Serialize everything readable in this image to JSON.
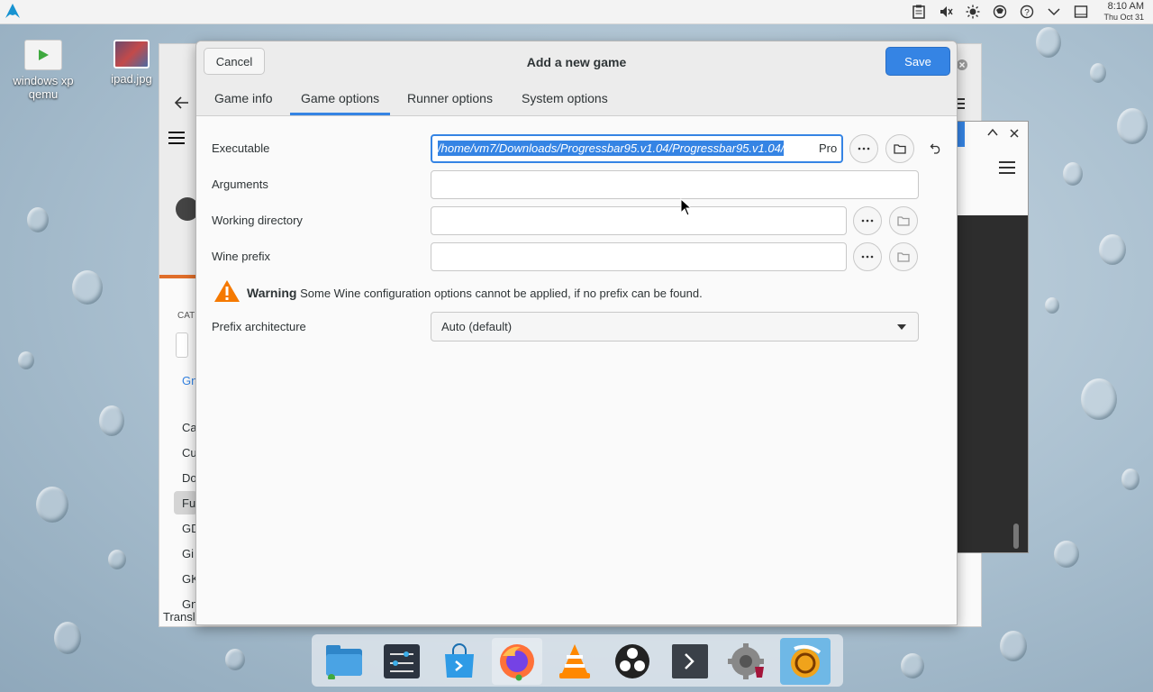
{
  "top_panel": {
    "time": "8:10 AM",
    "date": "Thu Oct 31",
    "tray_icons": [
      "clipboard-icon",
      "volume-muted-icon",
      "brightness-icon",
      "network-icon",
      "help-icon",
      "chevron-down-icon",
      "window-icon"
    ]
  },
  "desktop": {
    "icons": [
      {
        "label": "windows xp qemu",
        "icon": "play-icon"
      },
      {
        "label": "ipad.jpg",
        "icon": "image-icon"
      }
    ]
  },
  "background_windows": {
    "left_window_fragments": [
      "CATE",
      "Gn",
      "Ca",
      "Cu",
      "Do",
      "Fu",
      "GD",
      "Gi",
      "GK",
      "Gn",
      "Transl"
    ]
  },
  "dialog": {
    "title": "Add a new game",
    "cancel_label": "Cancel",
    "save_label": "Save",
    "tabs": [
      {
        "label": "Game info",
        "active": false
      },
      {
        "label": "Game options",
        "active": true
      },
      {
        "label": "Runner options",
        "active": false
      },
      {
        "label": "System options",
        "active": false
      }
    ],
    "executable": {
      "label": "Executable",
      "value_selected": "/home/vm7/Downloads/Progressbar95.v1.04/Progressbar95.v1.04/",
      "value_rest": "Pro"
    },
    "arguments": {
      "label": "Arguments",
      "value": ""
    },
    "working_directory": {
      "label": "Working directory",
      "value": ""
    },
    "wine_prefix": {
      "label": "Wine prefix",
      "value": ""
    },
    "warning": {
      "title": "Warning",
      "message": "Some Wine configuration options cannot be applied, if no prefix can be found."
    },
    "prefix_architecture": {
      "label": "Prefix architecture",
      "value": "Auto (default)"
    }
  },
  "dock": {
    "apps": [
      "files-icon",
      "settings-panel-icon",
      "software-store-icon",
      "firefox-icon",
      "vlc-icon",
      "obs-icon",
      "terminal-icon",
      "wine-settings-icon",
      "lutris-icon"
    ]
  },
  "colors": {
    "accent": "#3584e4",
    "header_bg": "#ececec",
    "dialog_bg": "#fafafa",
    "warning": "#f57900"
  }
}
